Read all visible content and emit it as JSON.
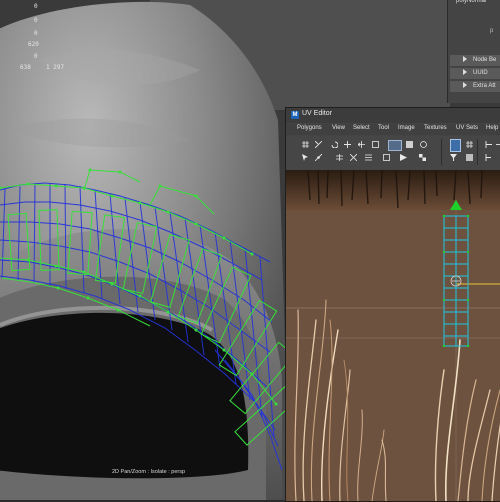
{
  "hud": {
    "stats_col1": [
      "0",
      "0",
      "0",
      "620",
      "0",
      "638"
    ],
    "stats_col2": [
      "1 297"
    ],
    "bottom_bar": "2D Pan/Zoom : Isolate : persp"
  },
  "attribute_editor": {
    "top_field": "polyNormal",
    "p_label": "p",
    "sections": [
      {
        "label": "Node Be"
      },
      {
        "label": "UUID"
      },
      {
        "label": "Extra Att"
      }
    ]
  },
  "uv_editor": {
    "title": "UV Editor",
    "logo": "M",
    "menu": [
      "Polygons",
      "View",
      "Select",
      "Tool",
      "Image",
      "Textures",
      "UV Sets",
      "Help"
    ],
    "colors": {
      "wire_green": "#37e03a",
      "wire_blue": "#2233d8",
      "uv_shell_cyan": "#19c8e0",
      "pivot_green": "#1fd22a",
      "axis_yellow": "#e8c23a",
      "texture_brown": "#6b4c36"
    }
  }
}
